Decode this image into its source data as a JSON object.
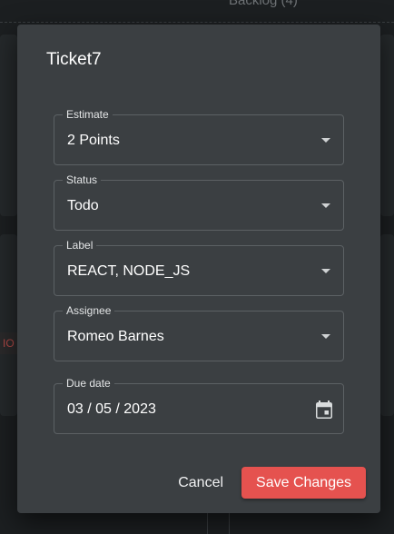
{
  "background": {
    "column_header": "Backlog (4)",
    "tag_fragment": "IO"
  },
  "modal": {
    "title": "Ticket7",
    "fields": {
      "estimate": {
        "label": "Estimate",
        "value": "2 Points",
        "icon": "chevron-down-icon"
      },
      "status": {
        "label": "Status",
        "value": "Todo",
        "icon": "chevron-down-icon"
      },
      "label": {
        "label": "Label",
        "value": "REACT, NODE_JS",
        "icon": "chevron-down-icon"
      },
      "assignee": {
        "label": "Assignee",
        "value": "Romeo Barnes",
        "icon": "chevron-down-icon"
      },
      "due_date": {
        "label": "Due date",
        "value": "03 / 05 / 2023",
        "icon": "calendar-icon"
      }
    },
    "actions": {
      "cancel_label": "Cancel",
      "save_label": "Save Changes"
    }
  },
  "colors": {
    "modal_bg": "#3b3f42",
    "accent": "#e5524f",
    "text": "#ffffff"
  }
}
